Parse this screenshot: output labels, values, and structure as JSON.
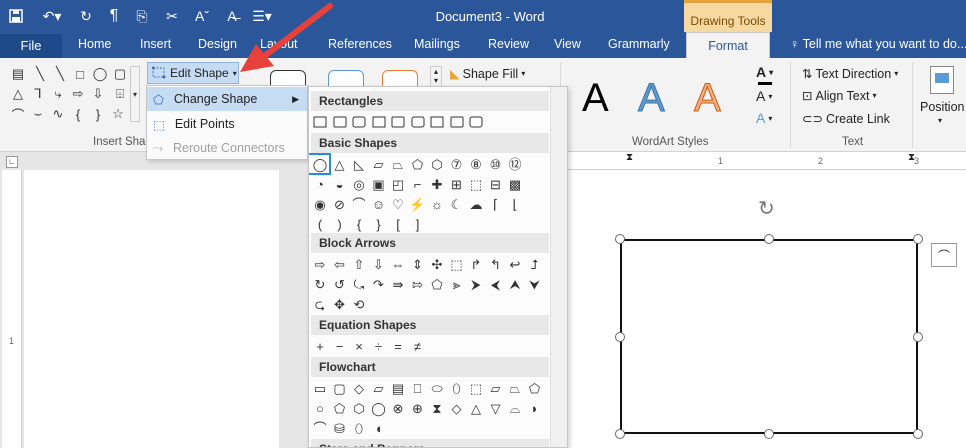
{
  "titlebar": {
    "title": "Document3 - Word",
    "contextual_group": "Drawing Tools",
    "qat": [
      "save-icon",
      "undo-icon",
      "redo-icon",
      "paragraph-icon",
      "copy-icon",
      "cut-icon",
      "font-size-icon",
      "clear-format-icon",
      "list-icon"
    ]
  },
  "tabs": {
    "file": "File",
    "items": [
      "Home",
      "Insert",
      "Design",
      "Layout",
      "References",
      "Mailings",
      "Review",
      "View",
      "Grammarly"
    ],
    "format": "Format",
    "tellme": "Tell me what you want to do..."
  },
  "ribbon": {
    "insert_shapes_label": "Insert Shap",
    "edit_shape": "Edit Shape",
    "shape_fill": "Shape Fill",
    "wordart_label": "WordArt Styles",
    "wordart_sample": "A",
    "text_direction": "Text Direction",
    "align_text": "Align Text",
    "create_link": "Create Link",
    "text_label": "Text",
    "position": "Position"
  },
  "edit_menu": {
    "items": [
      {
        "label": "Change Shape",
        "has_submenu": true,
        "enabled": true
      },
      {
        "label": "Edit Points",
        "has_submenu": false,
        "enabled": true
      },
      {
        "label": "Reroute Connectors",
        "has_submenu": false,
        "enabled": false
      }
    ]
  },
  "gallery": {
    "categories": [
      "Rectangles",
      "Basic Shapes",
      "Block Arrows",
      "Equation Shapes",
      "Flowchart",
      "Stars and Banners"
    ],
    "basic_row3": [
      "(",
      ")",
      "{",
      "}",
      "[",
      "]"
    ],
    "equation": [
      "+",
      "−",
      "×",
      "÷",
      "=",
      "≠"
    ]
  },
  "ruler": {
    "marks": [
      "1",
      "2",
      "3"
    ]
  },
  "colors": {
    "accent": "#2b579a",
    "highlight": "#c5dcf3",
    "arrow": "#e8413b",
    "selected_shape_border": "#1e90d8"
  }
}
